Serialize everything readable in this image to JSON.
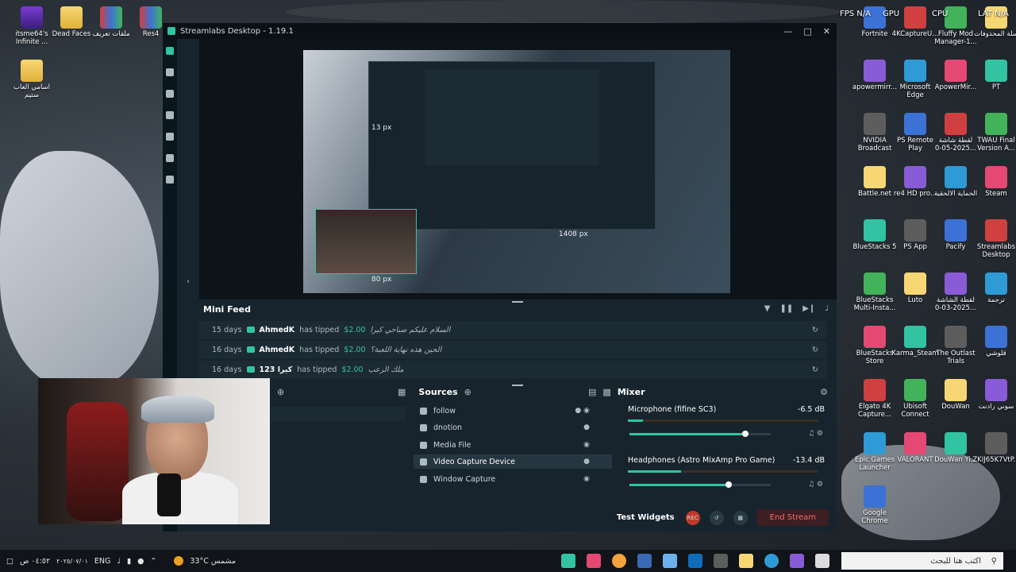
{
  "app": {
    "title": "Streamlabs Desktop - 1.19.1",
    "accent": "#31c3a2"
  },
  "desktop_icons_left": [
    {
      "label": "itsme64's Infinite ..."
    },
    {
      "label": "Dead Faces"
    },
    {
      "label": "ملفات تعريف"
    },
    {
      "label": "Res4"
    },
    {
      "label": "اسامي العاب ستيم"
    }
  ],
  "desktop_icons_right": [
    {
      "label": "Fortnite"
    },
    {
      "label": "4KCaptureU..."
    },
    {
      "label": "Fluffy Mod Manager-1..."
    },
    {
      "label": "سلة المحذوفات"
    },
    {
      "label": "apowermirr..."
    },
    {
      "label": "Microsoft Edge"
    },
    {
      "label": "ApowerMir..."
    },
    {
      "label": "PT"
    },
    {
      "label": "NVIDIA Broadcast"
    },
    {
      "label": "PS Remote Play"
    },
    {
      "label": "لقطة شاشة 2025-05-0..."
    },
    {
      "label": "TWAU Final Version A..."
    },
    {
      "label": "Battle.net"
    },
    {
      "label": "re4 HD pro..."
    },
    {
      "label": "الحماية الالحقية"
    },
    {
      "label": "Steam"
    },
    {
      "label": "BlueStacks 5"
    },
    {
      "label": "PS App"
    },
    {
      "label": "Pacify"
    },
    {
      "label": "Streamlabs Desktop"
    },
    {
      "label": "BlueStacks Multi-Insta..."
    },
    {
      "label": "Luto"
    },
    {
      "label": "لقطة الشاشة 2025-03-0..."
    },
    {
      "label": "ترجمة"
    },
    {
      "label": "BlueStacks Store"
    },
    {
      "label": "Karma_Steam"
    },
    {
      "label": "The Outlast Trials"
    },
    {
      "label": "قلوشي"
    },
    {
      "label": "Elgato 4K Capture..."
    },
    {
      "label": "Ubisoft Connect"
    },
    {
      "label": "DouWan"
    },
    {
      "label": "سوني رادنت"
    },
    {
      "label": "Epic Games Launcher"
    },
    {
      "label": "VALORANT"
    },
    {
      "label": "DouWan Yi..."
    },
    {
      "label": "ZKIJ65K7VtP..."
    },
    {
      "label": "Google Chrome"
    }
  ],
  "perf": {
    "fps": "FPS N/A",
    "gpu": "GPU",
    "cpu": "CPU",
    "lat": "LAT N/A"
  },
  "preview": {
    "px_top": "13 px",
    "px_right": "1408 px",
    "px_bottom": "80 px"
  },
  "mini_feed": {
    "title": "Mini Feed",
    "rows": [
      {
        "ago": "15 days",
        "user": "AhmedK",
        "action": "has tipped",
        "amount": "$2.00",
        "message": "السلام عليكم صباحي كيرا"
      },
      {
        "ago": "16 days",
        "user": "AhmedK",
        "action": "has tipped",
        "amount": "$2.00",
        "message": "الحين هذه نهاية اللعبة؟"
      },
      {
        "ago": "16 days",
        "user": "كيرا 123",
        "action": "has tipped",
        "amount": "$2.00",
        "message": "ملك الرعب"
      }
    ]
  },
  "sources": {
    "title": "Sources",
    "items": [
      {
        "label": "follow"
      },
      {
        "label": "dnotion"
      },
      {
        "label": "Media File"
      },
      {
        "label": "Video Capture Device"
      },
      {
        "label": "Window Capture"
      }
    ]
  },
  "mixer": {
    "title": "Mixer",
    "channels": [
      {
        "label": "Microphone (fifine SC3)",
        "db": "-6.5 dB",
        "volume": 0.8,
        "level": 0.08
      },
      {
        "label": "Headphones (Astro MixAmp Pro Game)",
        "db": "-13.4 dB",
        "volume": 0.68,
        "level": 0.28
      }
    ]
  },
  "footer": {
    "test_widgets": "Test Widgets",
    "rec": "REC",
    "end_stream": "End Stream"
  },
  "taskbar": {
    "lang": "ENG",
    "weather": "33°C مشمس",
    "time": "٠٤:٥٢ ص",
    "date": "٢٠٢٥/٠٧/٠١",
    "search_placeholder": "اكتب هنا للبحث"
  }
}
